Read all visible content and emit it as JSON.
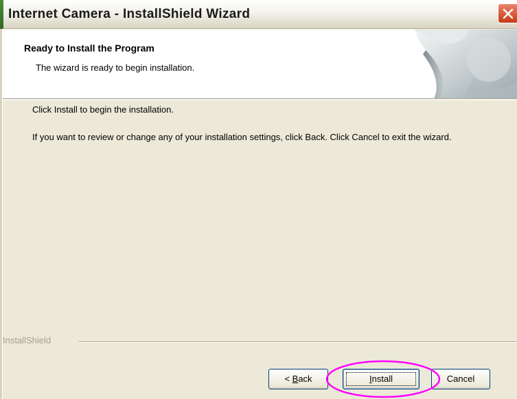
{
  "window": {
    "title": "Internet Camera - InstallShield Wizard"
  },
  "header": {
    "title": "Ready to Install the Program",
    "subtitle": "The wizard is ready to begin installation."
  },
  "body": {
    "line1": "Click Install to begin the installation.",
    "line2": "If you want to review or change any of your installation settings, click Back. Click Cancel to exit the wizard."
  },
  "footer": {
    "brand": "InstallShield"
  },
  "buttons": {
    "back": "< Back",
    "install": "Install",
    "cancel": "Cancel"
  },
  "colors": {
    "highlight": "#ff00ff",
    "close_button": "#c63a14"
  }
}
